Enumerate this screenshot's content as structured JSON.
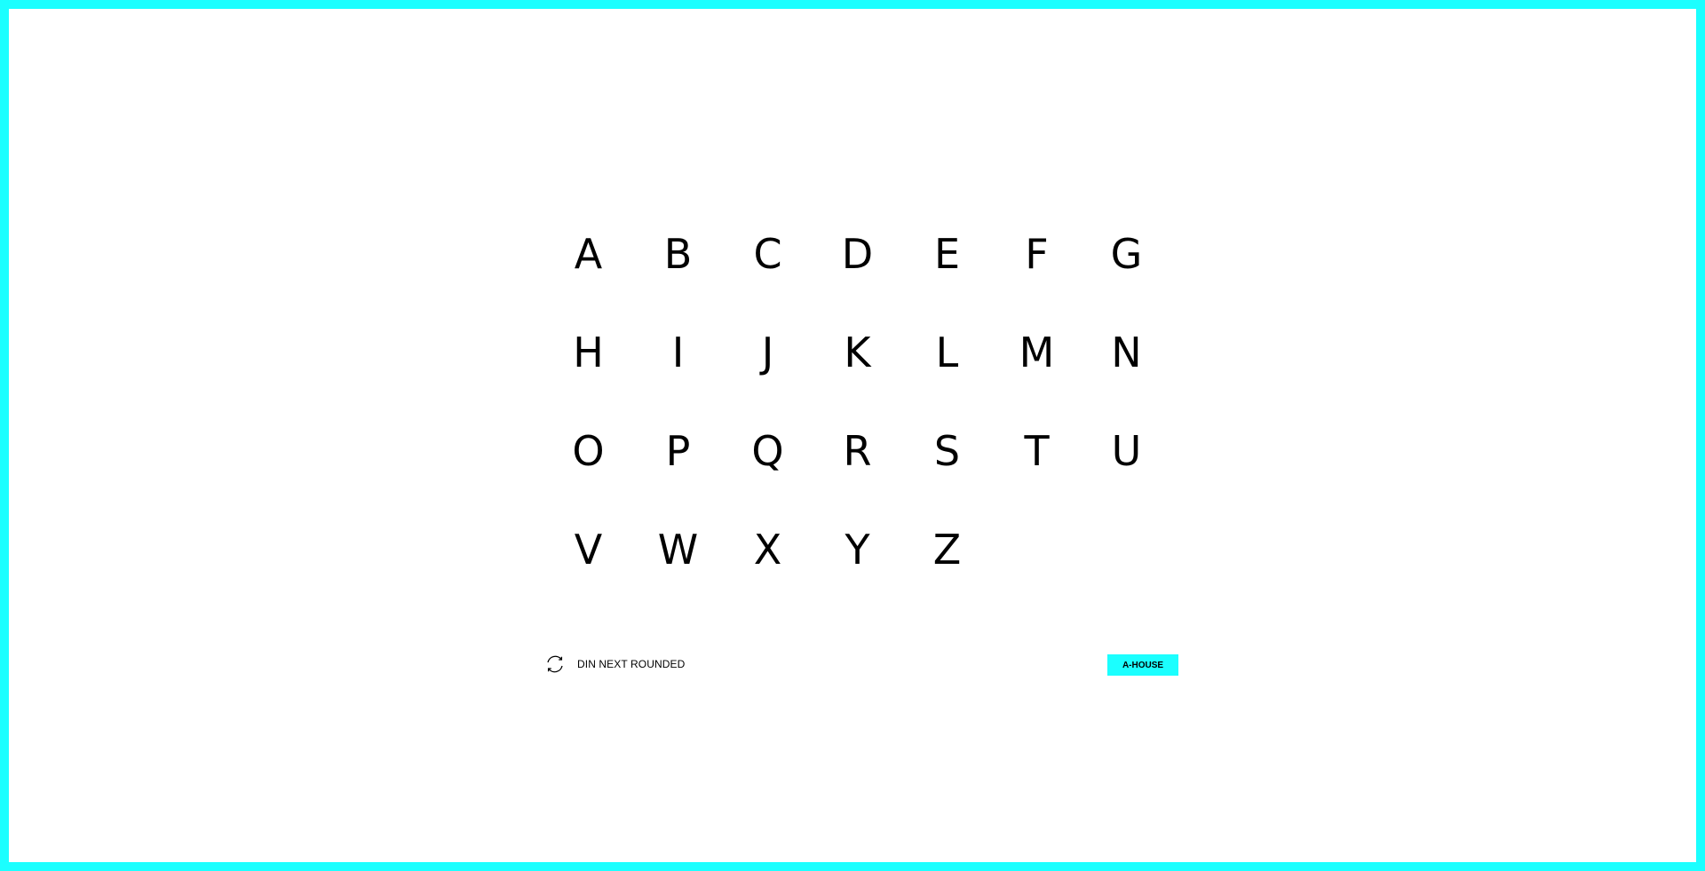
{
  "colors": {
    "accent": "#1bffff",
    "background": "#ffffff",
    "text": "#000000"
  },
  "alphabet": {
    "letters": [
      "A",
      "B",
      "C",
      "D",
      "E",
      "F",
      "G",
      "H",
      "I",
      "J",
      "K",
      "L",
      "M",
      "N",
      "O",
      "P",
      "Q",
      "R",
      "S",
      "T",
      "U",
      "V",
      "W",
      "X",
      "Y",
      "Z"
    ]
  },
  "font_switcher": {
    "icon": "refresh-icon",
    "label": "DIN NEXT ROUNDED"
  },
  "brand_button": {
    "label": "A-HOUSE"
  }
}
